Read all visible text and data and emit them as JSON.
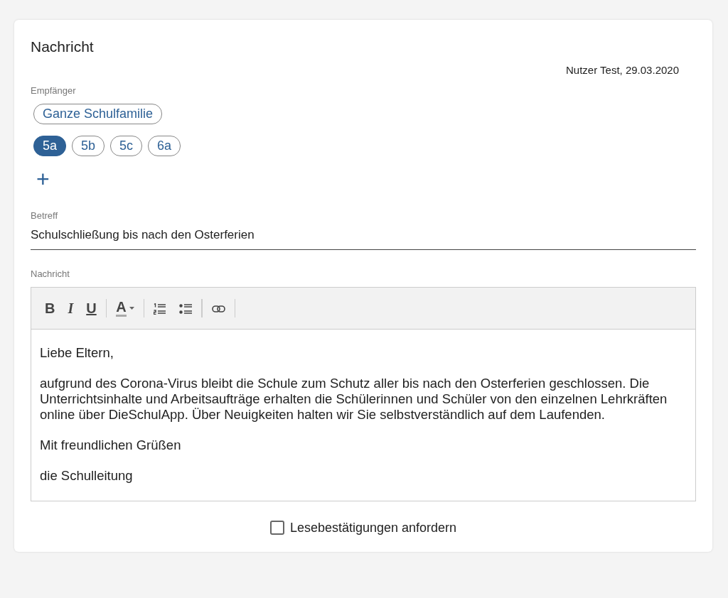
{
  "card": {
    "title": "Nachricht",
    "meta": "Nutzer Test, 29.03.2020"
  },
  "recipients": {
    "label": "Empfänger",
    "groups": [
      {
        "label": "Ganze Schulfamilie",
        "selected": false
      }
    ],
    "classes": [
      {
        "label": "5a",
        "selected": true
      },
      {
        "label": "5b",
        "selected": false
      },
      {
        "label": "5c",
        "selected": false
      },
      {
        "label": "6a",
        "selected": false
      }
    ],
    "add_button": "+"
  },
  "subject": {
    "label": "Betreff",
    "value": "Schulschließung bis nach den Osterferien"
  },
  "message": {
    "label": "Nachricht",
    "toolbar": [
      {
        "kind": "bold",
        "label": "B"
      },
      {
        "kind": "italic",
        "label": "I"
      },
      {
        "kind": "underline",
        "label": "U"
      },
      {
        "kind": "separator"
      },
      {
        "kind": "color",
        "label": "A"
      },
      {
        "kind": "separator"
      },
      {
        "kind": "ordered-list"
      },
      {
        "kind": "bullet-list"
      },
      {
        "kind": "separator"
      },
      {
        "kind": "link"
      },
      {
        "kind": "separator"
      }
    ],
    "paragraphs": [
      "Liebe Eltern,",
      "aufgrund des Corona-Virus bleibt die Schule zum Schutz aller bis nach den Osterferien geschlossen. Die Unterrichtsinhalte und Arbeitsaufträge erhalten die Schülerinnen und Schüler von den einzelnen Lehrkräften online über DieSchulApp. Über Neuigkeiten halten wir Sie selbstverständlich auf dem Laufenden.",
      "Mit freundlichen Grüßen",
      "die Schulleitung"
    ]
  },
  "read_receipt": {
    "label": "Lesebestätigungen anfordern",
    "checked": false
  }
}
